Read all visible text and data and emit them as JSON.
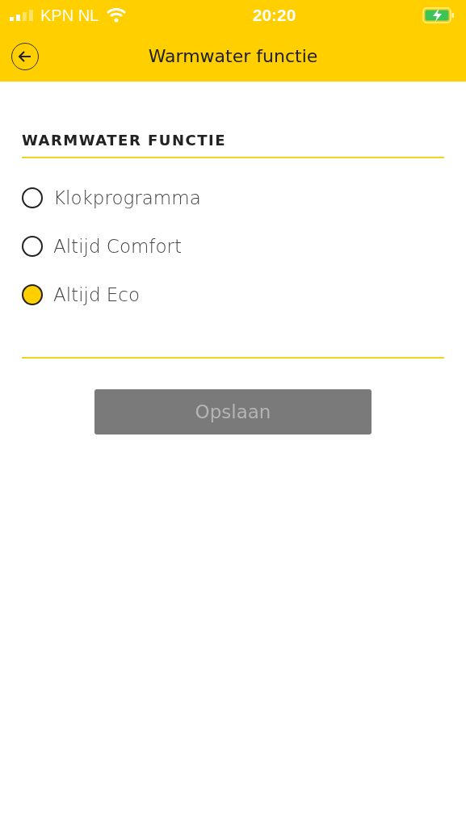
{
  "status_bar": {
    "carrier": "KPN NL",
    "time": "20:20",
    "charging": true
  },
  "header": {
    "title": "Warmwater functie"
  },
  "section": {
    "title": "WARMWATER FUNCTIE"
  },
  "options": [
    {
      "label": "Klokprogramma",
      "selected": false
    },
    {
      "label": "Altijd Comfort",
      "selected": false
    },
    {
      "label": "Altijd Eco",
      "selected": true
    }
  ],
  "save_button": {
    "label": "Opslaan",
    "disabled": true
  }
}
